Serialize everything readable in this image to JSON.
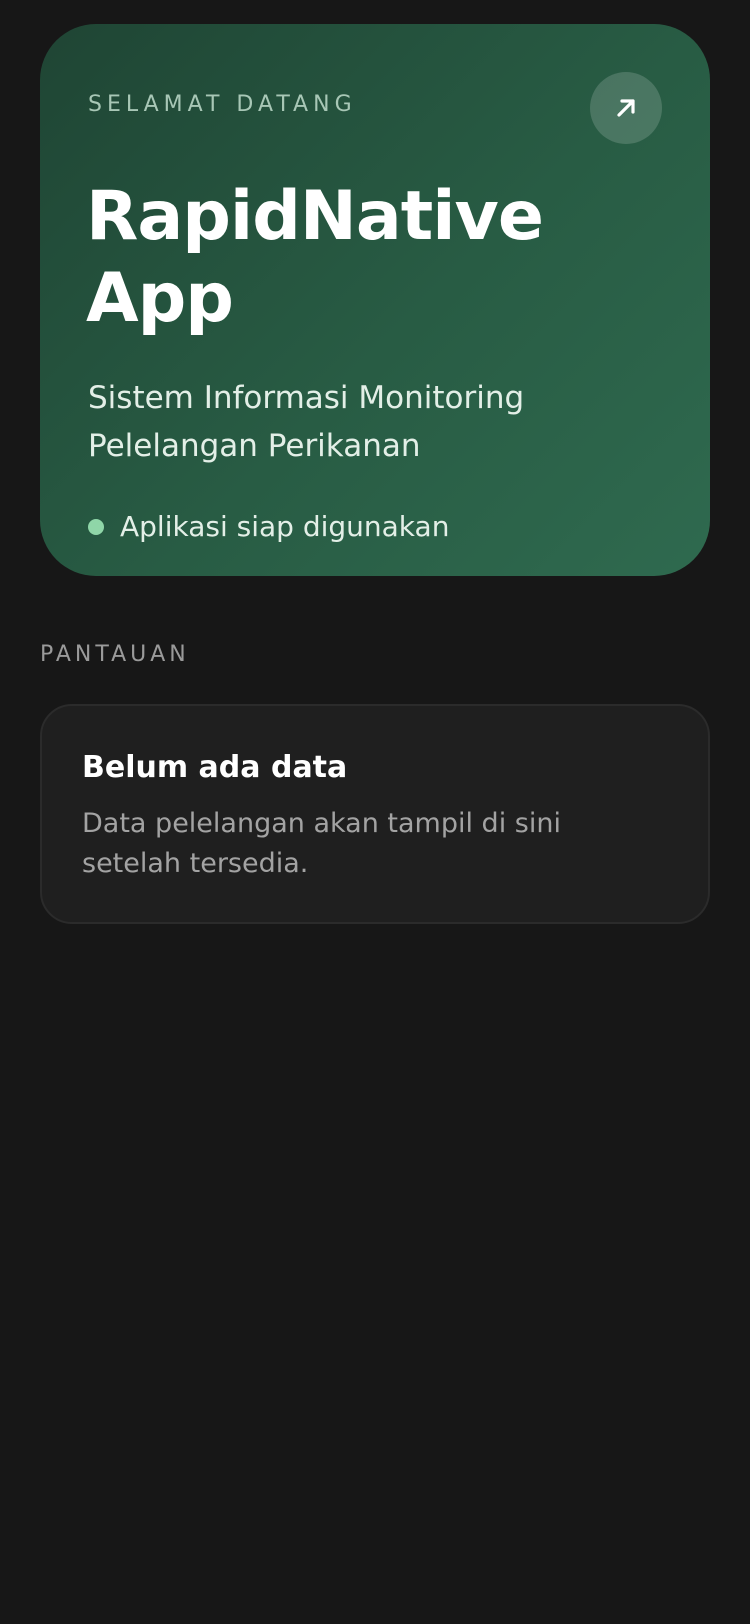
{
  "hero": {
    "eyebrow": "SELAMAT DATANG",
    "title": "RapidNative App",
    "subtitle": "Sistem Informasi Monitoring Pelelangan Perikanan",
    "status_text": "Aplikasi siap digunakan",
    "action_icon": "arrow-up-right-icon",
    "status_color": "#8fd6a8",
    "card_color": "#285c44"
  },
  "monitoring": {
    "section_label": "PANTAUAN",
    "empty_title": "Belum ada data",
    "empty_description": "Data pelelangan akan tampil di sini setelah tersedia."
  },
  "theme": {
    "background": "#171717"
  }
}
